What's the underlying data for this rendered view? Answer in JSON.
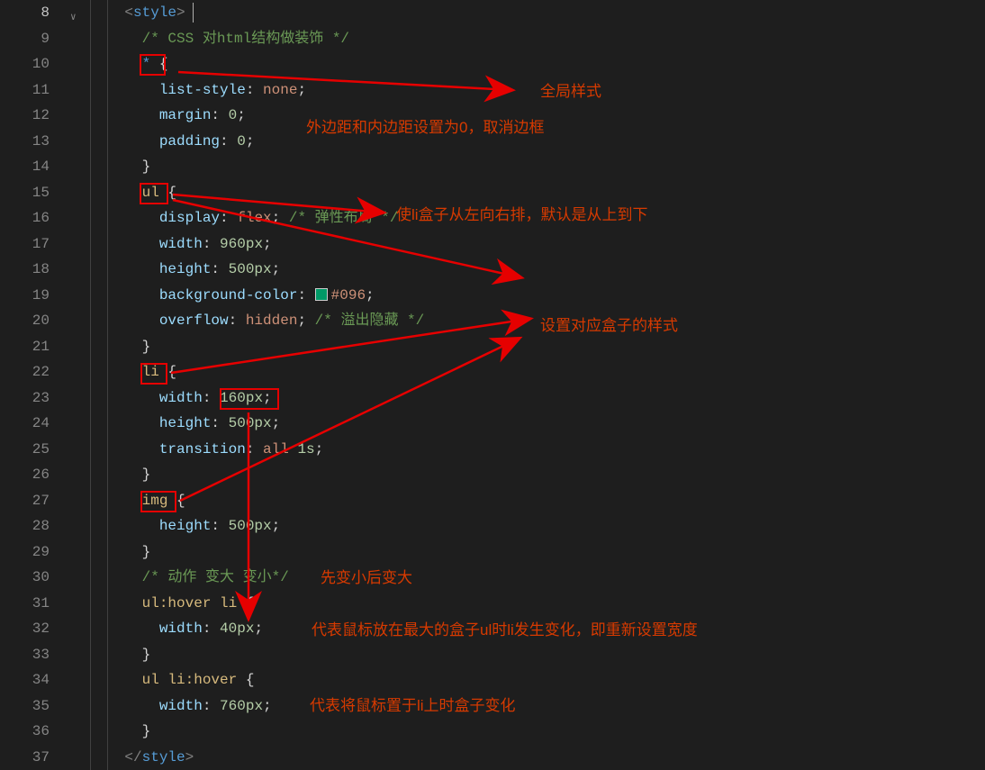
{
  "lines": {
    "start": 8,
    "end": 37,
    "active": 8
  },
  "code": [
    {
      "n": 8,
      "indent": 2,
      "tokens": [
        [
          "brkt",
          "<"
        ],
        [
          "tag",
          "style"
        ],
        [
          "brkt",
          ">"
        ]
      ]
    },
    {
      "n": 9,
      "indent": 3,
      "tokens": [
        [
          "cmt",
          "/* CSS 对html结构做装饰 */"
        ]
      ]
    },
    {
      "n": 10,
      "indent": 3,
      "tokens": [
        [
          "wild",
          "*"
        ],
        [
          "pn",
          " "
        ],
        [
          "brace",
          "{"
        ]
      ]
    },
    {
      "n": 11,
      "indent": 4,
      "tokens": [
        [
          "prop",
          "list-style"
        ],
        [
          "pn",
          ": "
        ],
        [
          "str",
          "none"
        ],
        [
          "pn",
          ";"
        ]
      ]
    },
    {
      "n": 12,
      "indent": 4,
      "tokens": [
        [
          "prop",
          "margin"
        ],
        [
          "pn",
          ": "
        ],
        [
          "num",
          "0"
        ],
        [
          "pn",
          ";"
        ]
      ]
    },
    {
      "n": 13,
      "indent": 4,
      "tokens": [
        [
          "prop",
          "padding"
        ],
        [
          "pn",
          ": "
        ],
        [
          "num",
          "0"
        ],
        [
          "pn",
          ";"
        ]
      ]
    },
    {
      "n": 14,
      "indent": 3,
      "tokens": [
        [
          "brace",
          "}"
        ]
      ]
    },
    {
      "n": 15,
      "indent": 3,
      "tokens": [
        [
          "sel",
          "ul"
        ],
        [
          "pn",
          " "
        ],
        [
          "brace",
          "{"
        ]
      ]
    },
    {
      "n": 16,
      "indent": 4,
      "tokens": [
        [
          "prop",
          "display"
        ],
        [
          "pn",
          ": "
        ],
        [
          "str",
          "flex"
        ],
        [
          "pn",
          "; "
        ],
        [
          "cmt",
          "/* 弹性布局 */"
        ]
      ]
    },
    {
      "n": 17,
      "indent": 4,
      "tokens": [
        [
          "prop",
          "width"
        ],
        [
          "pn",
          ": "
        ],
        [
          "num",
          "960px"
        ],
        [
          "pn",
          ";"
        ]
      ]
    },
    {
      "n": 18,
      "indent": 4,
      "tokens": [
        [
          "prop",
          "height"
        ],
        [
          "pn",
          ": "
        ],
        [
          "num",
          "500px"
        ],
        [
          "pn",
          ";"
        ]
      ]
    },
    {
      "n": 19,
      "indent": 4,
      "tokens": [
        [
          "prop",
          "background-color"
        ],
        [
          "pn",
          ": "
        ],
        [
          "swatch",
          "#096"
        ],
        [
          "str",
          "#096"
        ],
        [
          "pn",
          ";"
        ]
      ]
    },
    {
      "n": 20,
      "indent": 4,
      "tokens": [
        [
          "prop",
          "overflow"
        ],
        [
          "pn",
          ": "
        ],
        [
          "str",
          "hidden"
        ],
        [
          "pn",
          "; "
        ],
        [
          "cmt",
          "/* 溢出隐藏 */"
        ]
      ]
    },
    {
      "n": 21,
      "indent": 3,
      "tokens": [
        [
          "brace",
          "}"
        ]
      ]
    },
    {
      "n": 22,
      "indent": 3,
      "tokens": [
        [
          "sel",
          "li"
        ],
        [
          "pn",
          " "
        ],
        [
          "brace",
          "{"
        ]
      ]
    },
    {
      "n": 23,
      "indent": 4,
      "tokens": [
        [
          "prop",
          "width"
        ],
        [
          "pn",
          ": "
        ],
        [
          "num",
          "160px"
        ],
        [
          "pn",
          ";"
        ]
      ]
    },
    {
      "n": 24,
      "indent": 4,
      "tokens": [
        [
          "prop",
          "height"
        ],
        [
          "pn",
          ": "
        ],
        [
          "num",
          "500px"
        ],
        [
          "pn",
          ";"
        ]
      ]
    },
    {
      "n": 25,
      "indent": 4,
      "tokens": [
        [
          "prop",
          "transition"
        ],
        [
          "pn",
          ": "
        ],
        [
          "str",
          "all"
        ],
        [
          "pn",
          " "
        ],
        [
          "num",
          "1s"
        ],
        [
          "pn",
          ";"
        ]
      ]
    },
    {
      "n": 26,
      "indent": 3,
      "tokens": [
        [
          "brace",
          "}"
        ]
      ]
    },
    {
      "n": 27,
      "indent": 3,
      "tokens": [
        [
          "sel",
          "img"
        ],
        [
          "pn",
          " "
        ],
        [
          "brace",
          "{"
        ]
      ]
    },
    {
      "n": 28,
      "indent": 4,
      "tokens": [
        [
          "prop",
          "height"
        ],
        [
          "pn",
          ": "
        ],
        [
          "num",
          "500px"
        ],
        [
          "pn",
          ";"
        ]
      ]
    },
    {
      "n": 29,
      "indent": 3,
      "tokens": [
        [
          "brace",
          "}"
        ]
      ]
    },
    {
      "n": 30,
      "indent": 3,
      "tokens": [
        [
          "cmt",
          "/* 动作 变大 变小*/"
        ]
      ]
    },
    {
      "n": 31,
      "indent": 3,
      "tokens": [
        [
          "sel",
          "ul"
        ],
        [
          "psdo",
          ":hover"
        ],
        [
          "pn",
          " "
        ],
        [
          "sel",
          "li"
        ],
        [
          "pn",
          " "
        ],
        [
          "brace",
          "{"
        ]
      ]
    },
    {
      "n": 32,
      "indent": 4,
      "tokens": [
        [
          "prop",
          "width"
        ],
        [
          "pn",
          ": "
        ],
        [
          "num",
          "40px"
        ],
        [
          "pn",
          ";"
        ]
      ]
    },
    {
      "n": 33,
      "indent": 3,
      "tokens": [
        [
          "brace",
          "}"
        ]
      ]
    },
    {
      "n": 34,
      "indent": 3,
      "tokens": [
        [
          "sel",
          "ul"
        ],
        [
          "pn",
          " "
        ],
        [
          "sel",
          "li"
        ],
        [
          "psdo",
          ":hover"
        ],
        [
          "pn",
          " "
        ],
        [
          "brace",
          "{"
        ]
      ]
    },
    {
      "n": 35,
      "indent": 4,
      "tokens": [
        [
          "prop",
          "width"
        ],
        [
          "pn",
          ": "
        ],
        [
          "num",
          "760px"
        ],
        [
          "pn",
          ";"
        ]
      ]
    },
    {
      "n": 36,
      "indent": 3,
      "tokens": [
        [
          "brace",
          "}"
        ]
      ]
    },
    {
      "n": 37,
      "indent": 2,
      "tokens": [
        [
          "brkt",
          "</"
        ],
        [
          "tag",
          "style"
        ],
        [
          "brkt",
          ">"
        ]
      ]
    }
  ],
  "annotations": {
    "global_style": "全局样式",
    "margin_padding_zero": "外边距和内边距设置为0，取消边框",
    "li_horizontal": "使li盒子从左向右排，默认是从上到下",
    "box_style": "设置对应盒子的样式",
    "shrink_grow": "先变小后变大",
    "hover_ul": "代表鼠标放在最大的盒子ul时li发生变化，即重新设置宽度",
    "hover_li": "代表将鼠标置于li上时盒子变化"
  },
  "color_swatch": "#096"
}
